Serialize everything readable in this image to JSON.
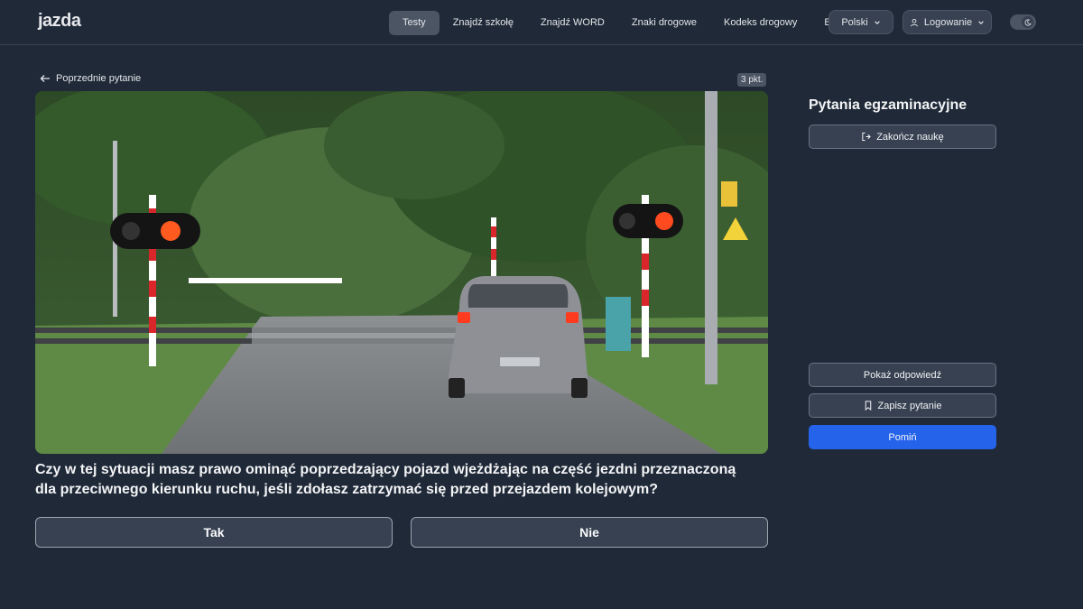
{
  "header": {
    "logo": "jazda",
    "nav": [
      "Testy",
      "Znajdź szkołę",
      "Znajdź WORD",
      "Znaki drogowe",
      "Kodeks drogowy",
      "Blog"
    ],
    "language": "Polski",
    "login": "Logowanie"
  },
  "main": {
    "back_label": "Poprzednie pytanie",
    "points": "3 pkt.",
    "question": "Czy w tej sytuacji masz prawo ominąć poprzedzający pojazd wjeżdżając na część jezdni przeznaczoną dla przeciwnego kierunku ruchu, jeśli zdołasz zatrzymać się przed przejazdem kolejowym?",
    "answers": [
      "Tak",
      "Nie"
    ]
  },
  "sidebar": {
    "title": "Pytania egzaminacyjne",
    "end_label": "Zakończ naukę",
    "show_answer_label": "Pokaż odpowiedź",
    "save_label": "Zapisz pytanie",
    "skip_label": "Pomiń"
  },
  "colors": {
    "background": "#1f2937",
    "accent": "#2563eb",
    "signal_red": "#ff3b1f"
  }
}
